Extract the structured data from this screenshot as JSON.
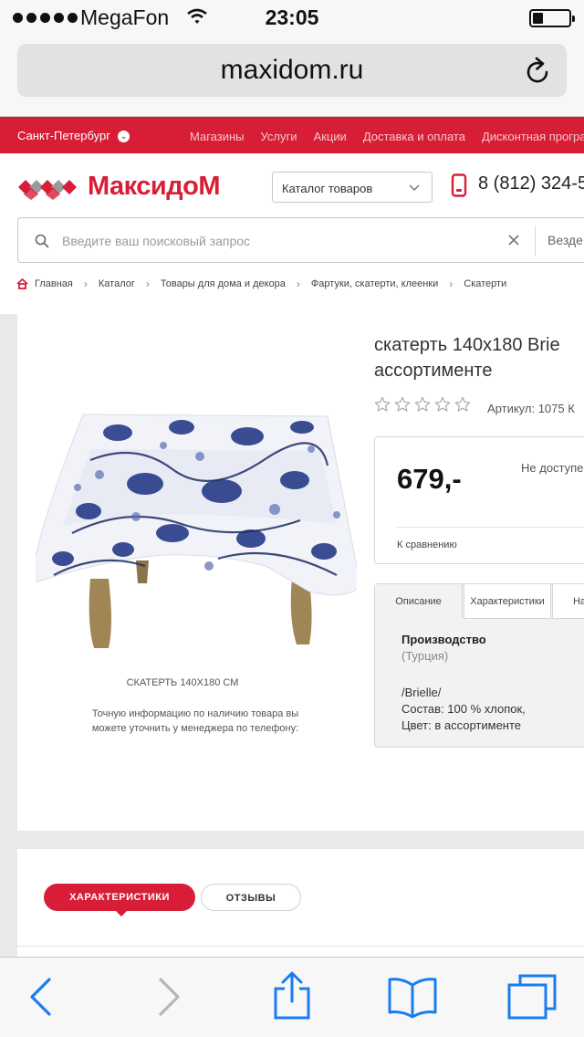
{
  "status_bar": {
    "carrier": "MegaFon",
    "time": "23:05",
    "battery_level": 0.3
  },
  "browser": {
    "url": "maxidom.ru"
  },
  "site": {
    "city": "Санкт-Петербург",
    "top_nav": [
      "Магазины",
      "Услуги",
      "Акции",
      "Доставка и оплата",
      "Дисконтная програ"
    ],
    "logo": "МаксидоМ",
    "catalog_select": "Каталог товаров",
    "phone": "8 (812) 324-5",
    "search": {
      "placeholder": "Введите ваш поисковый запрос",
      "value": "",
      "scope": "Везде"
    },
    "breadcrumbs": [
      "Главная",
      "Каталог",
      "Товары для дома и декора",
      "Фартуки, скатерти, клеенки",
      "Скатерти"
    ]
  },
  "product": {
    "title_line1": "скатерть 140х180 Brie",
    "title_line2": "ассортименте",
    "rating": 0,
    "rating_max": 5,
    "sku": "Артикул: 1075   К",
    "price": "679,-",
    "availability": "Не доступе",
    "compare": "К сравнению",
    "image_caption": "СКАТЕРТЬ 140Х180 СМ",
    "note": "Точную информацию по наличию товара вы можете уточнить у менеджера по телефону:",
    "tabs": [
      "Описание",
      "Характеристики",
      "На"
    ],
    "description": {
      "heading": "Производство",
      "origin": "(Турция)",
      "line1": "/Brielle/",
      "line2": "Состав: 100 % хлопок,",
      "line3": "Цвет: в ассортименте"
    }
  },
  "lower_tabs": [
    "ХАРАКТЕРИСТИКИ",
    "ОТЗЫВЫ"
  ],
  "colors": {
    "brand_red": "#d81e36",
    "ios_blue": "#1a7cf0",
    "pattern_blue": "#2b3f8a"
  },
  "toolbar_icons": [
    "back-icon",
    "forward-icon",
    "share-icon",
    "bookmarks-icon",
    "tabs-icon"
  ]
}
